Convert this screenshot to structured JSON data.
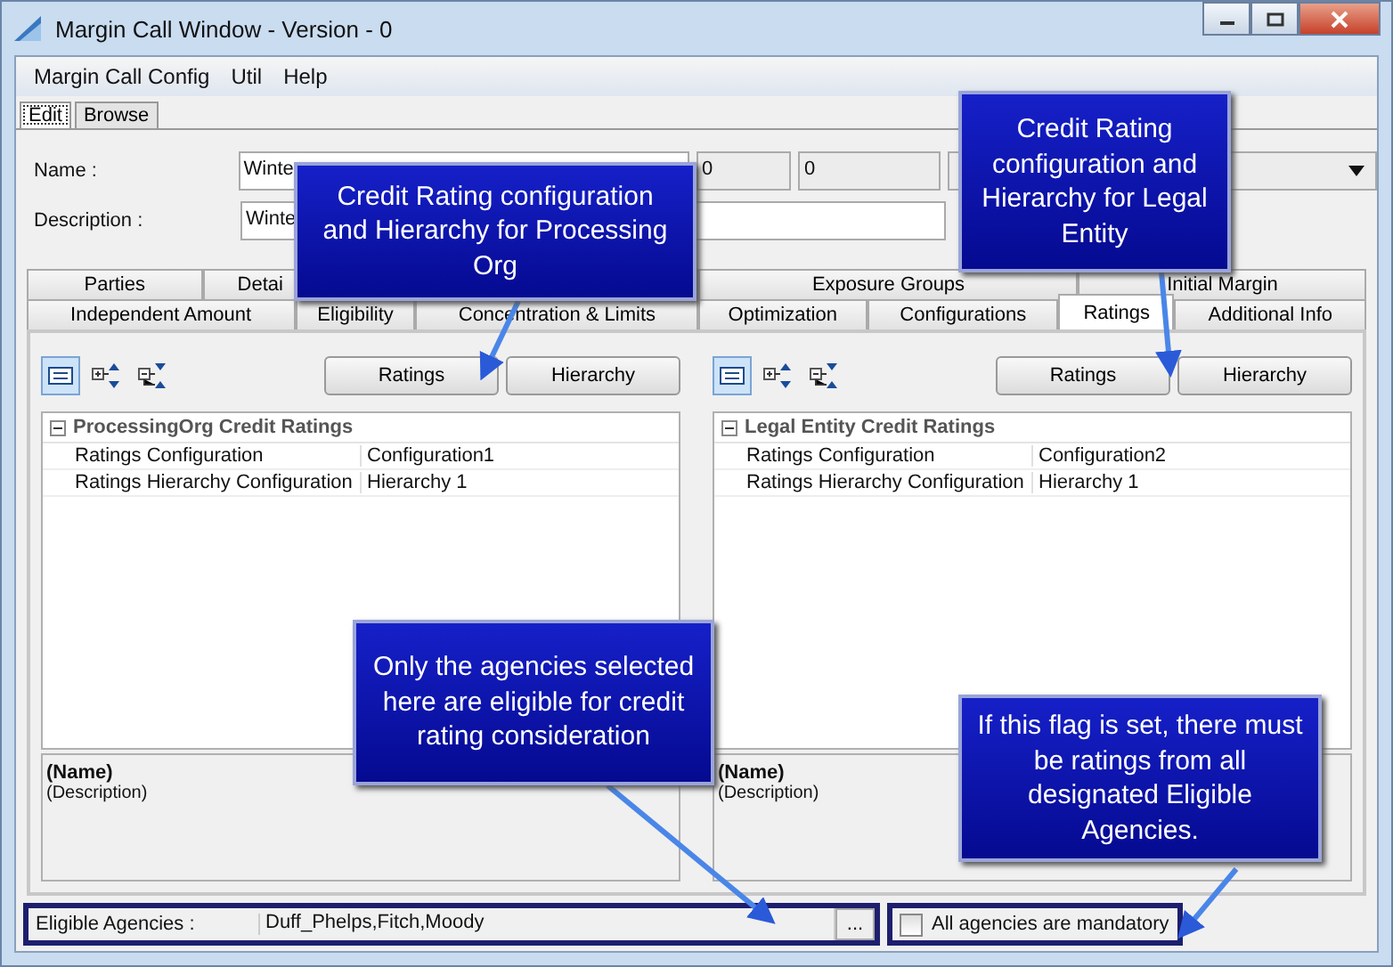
{
  "window": {
    "title": "Margin Call Window - Version - 0"
  },
  "menu": [
    "Margin Call Config",
    "Util",
    "Help"
  ],
  "mode_tabs": [
    {
      "label": "Edit",
      "selected": true
    },
    {
      "label": "Browse",
      "selected": false
    }
  ],
  "form": {
    "name_label": "Name :",
    "name_value": "Winte",
    "field_2": "0",
    "field_3": "0",
    "description_label": "Description :",
    "description_value": "Winte"
  },
  "tab_rows": [
    [
      {
        "label": "Parties",
        "selected": false
      },
      {
        "label": "Detai",
        "selected": false
      },
      {
        "selected": false
      },
      {
        "label": "Exposure Groups",
        "selected": false
      },
      {
        "label": "Initial Margin",
        "selected": false
      }
    ],
    [
      {
        "label": "Independent Amount",
        "selected": false
      },
      {
        "label": "Eligibility",
        "selected": false
      },
      {
        "label": "Concentration & Limits",
        "selected": false
      },
      {
        "label": "Optimization",
        "selected": false
      },
      {
        "label": "Configurations",
        "selected": false
      },
      {
        "label": "Ratings",
        "selected": true
      },
      {
        "label": "Additional Info",
        "selected": false
      }
    ]
  ],
  "panels": [
    {
      "buttons": [
        "Ratings",
        "Hierarchy"
      ],
      "group": "ProcessingOrg Credit Ratings",
      "expanded": true,
      "rows": [
        {
          "key": "Ratings Configuration",
          "value": "Configuration1"
        },
        {
          "key": "Ratings Hierarchy Configuration",
          "value": "Hierarchy 1"
        }
      ],
      "info_name": "(Name)",
      "info_description": "(Description)"
    },
    {
      "buttons": [
        "Ratings",
        "Hierarchy"
      ],
      "group": "Legal Entity Credit Ratings",
      "expanded": true,
      "rows": [
        {
          "key": "Ratings Configuration",
          "value": "Configuration2"
        },
        {
          "key": "Ratings Hierarchy Configuration",
          "value": "Hierarchy 1"
        }
      ],
      "info_name": "(Name)",
      "info_description": "(Description)"
    }
  ],
  "eligible_agencies": {
    "label": "Eligible Agencies :",
    "value": "Duff_Phelps,Fitch,Moody",
    "browse": "..."
  },
  "all_mandatory": {
    "label": "All agencies are mandatory",
    "checked": false
  },
  "callouts": [
    "Credit Rating configuration and Hierarchy for Processing Org",
    "Credit Rating configuration and Hierarchy for Legal Entity",
    "Only the agencies selected here are eligible for credit rating consideration",
    "If this flag is set, there must be ratings from all designated Eligible Agencies."
  ]
}
